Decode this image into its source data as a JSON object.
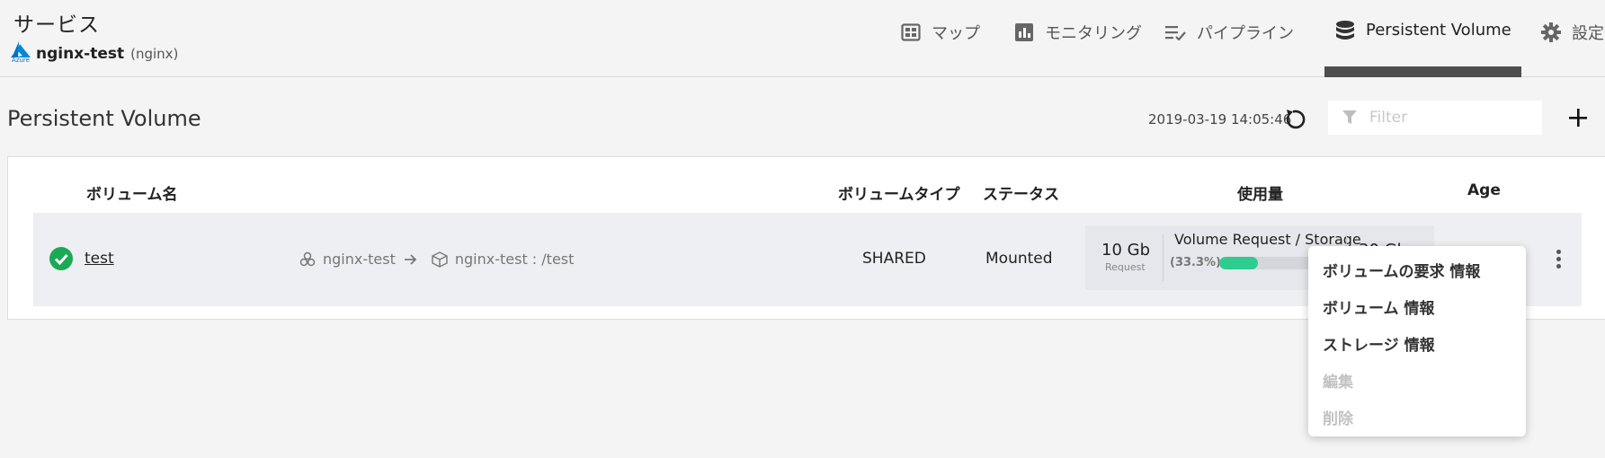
{
  "header": {
    "title": "サービス",
    "service_name": "nginx-test",
    "service_sub": "(nginx)",
    "provider_logo_text": "Azure",
    "nav": [
      {
        "label": "マップ",
        "icon": "map-icon"
      },
      {
        "label": "モニタリング",
        "icon": "bar-chart-icon"
      },
      {
        "label": "パイプライン",
        "icon": "pipeline-icon"
      },
      {
        "label": "Persistent Volume",
        "icon": "database-icon",
        "active": true
      },
      {
        "label": "設定",
        "icon": "gear-icon"
      }
    ]
  },
  "page": {
    "title": "Persistent Volume",
    "timestamp": "2019-03-19 14:05:46",
    "filter_placeholder": "Filter",
    "filter_value": ""
  },
  "table": {
    "columns": {
      "name": "ボリューム名",
      "type": "ボリュームタイプ",
      "status": "ステータス",
      "usage": "使用量",
      "age": "Age"
    },
    "rows": [
      {
        "status_icon": "check-circle-icon",
        "name": "test",
        "source": "nginx-test",
        "mount": "nginx-test : /test",
        "type": "SHARED",
        "status": "Mounted",
        "usage": {
          "request_value": "10 Gb",
          "request_label": "Request",
          "ratio_label": "Volume Request / Storage",
          "percent_text": "(33.3%)",
          "percent": 33.3,
          "capacity_value": "30 Gb"
        }
      }
    ]
  },
  "context_menu": {
    "items": [
      {
        "label": "ボリュームの要求 情報",
        "enabled": true
      },
      {
        "label": "ボリューム 情報",
        "enabled": true
      },
      {
        "label": "ストレージ 情報",
        "enabled": true
      },
      {
        "label": "編集",
        "enabled": false
      },
      {
        "label": "削除",
        "enabled": false
      }
    ]
  },
  "colors": {
    "status_ok": "#1aaa55",
    "usage_fill": "#2ecc8f",
    "active_tab_underline": "#4d4d4d",
    "azure_blue": "#0072c6"
  }
}
